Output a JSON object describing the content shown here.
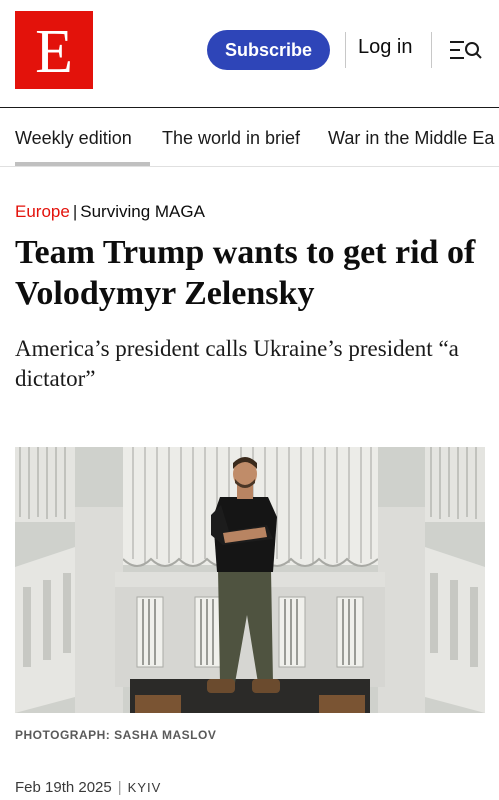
{
  "header": {
    "logo_letter": "E",
    "subscribe_label": "Subscribe",
    "login_label": "Log in",
    "brand_color": "#e3120b",
    "subscribe_color": "#2e45b8"
  },
  "nav": {
    "items": [
      {
        "label": "Weekly edition"
      },
      {
        "label": "The world in brief"
      },
      {
        "label": "War in the Middle Ea"
      }
    ]
  },
  "article": {
    "section": "Europe",
    "series": "Surviving MAGA",
    "headline": "Team Trump wants to get rid of Volodymyr Zelensky",
    "standfirst": "America’s president calls Ukraine’s president “a dictator”",
    "photo_credit": "PHOTOGRAPH: SASHA MASLOV",
    "date": "Feb 19th 2025",
    "location": "KYIV"
  }
}
